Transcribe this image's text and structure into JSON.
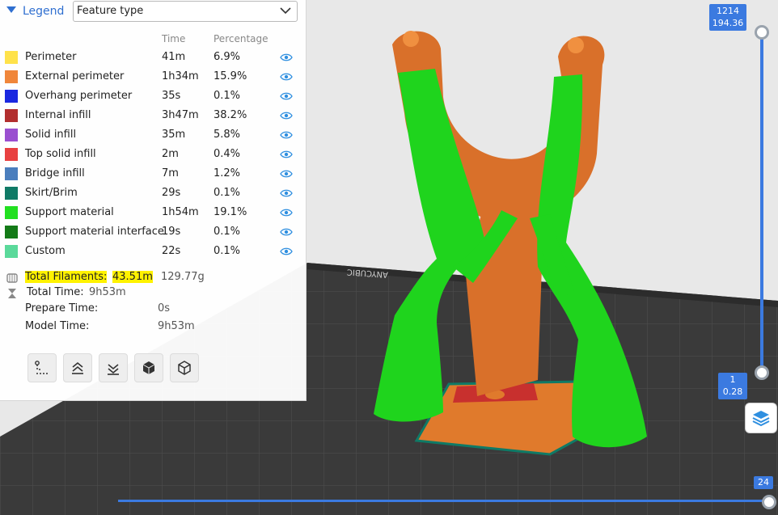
{
  "legend": {
    "title": "Legend",
    "view_type": "Feature type",
    "col_time": "Time",
    "col_percentage": "Percentage",
    "items": [
      {
        "name": "Perimeter",
        "time": "41m",
        "pct": "6.9%",
        "color": "#ffe24a"
      },
      {
        "name": "External perimeter",
        "time": "1h34m",
        "pct": "15.9%",
        "color": "#f0863a"
      },
      {
        "name": "Overhang perimeter",
        "time": "35s",
        "pct": "0.1%",
        "color": "#1a28e0"
      },
      {
        "name": "Internal infill",
        "time": "3h47m",
        "pct": "38.2%",
        "color": "#b22e2e"
      },
      {
        "name": "Solid infill",
        "time": "35m",
        "pct": "5.8%",
        "color": "#9a4fd0"
      },
      {
        "name": "Top solid infill",
        "time": "2m",
        "pct": "0.4%",
        "color": "#e84040"
      },
      {
        "name": "Bridge infill",
        "time": "7m",
        "pct": "1.2%",
        "color": "#4a7ebd"
      },
      {
        "name": "Skirt/Brim",
        "time": "29s",
        "pct": "0.1%",
        "color": "#0f7a66"
      },
      {
        "name": "Support material",
        "time": "1h54m",
        "pct": "19.1%",
        "color": "#22e020"
      },
      {
        "name": "Support material interface",
        "time": "19s",
        "pct": "0.1%",
        "color": "#137a17"
      },
      {
        "name": "Custom",
        "time": "22s",
        "pct": "0.1%",
        "color": "#5ad99a"
      }
    ],
    "total_filaments_label": "Total Filaments:",
    "total_filaments_length": "43.51m",
    "total_filaments_weight": "129.77g",
    "total_time_label": "Total Time:",
    "total_time": "9h53m",
    "prepare_time_label": "Prepare Time:",
    "prepare_time": "0s",
    "model_time_label": "Model Time:",
    "model_time": "9h53m"
  },
  "toolbar_icons": [
    "travel-path-icon",
    "layer-up-icon",
    "layer-down-icon",
    "solid-cube-icon",
    "wireframe-cube-icon"
  ],
  "bed_brand": "ANYCUBIC",
  "layer_slider": {
    "top_layer": "1214",
    "top_height": "194.36",
    "bottom_layer": "1",
    "bottom_height": "0.28",
    "accent": "#3b7ae0"
  },
  "move_slider": {
    "value": "24"
  }
}
